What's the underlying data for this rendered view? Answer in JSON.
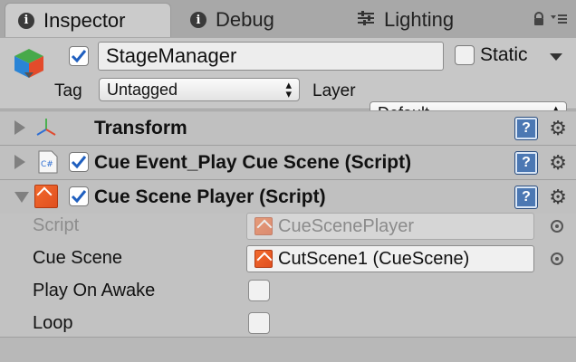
{
  "tabs": [
    {
      "label": "Inspector",
      "icon": "info-icon",
      "active": true
    },
    {
      "label": "Debug",
      "icon": "info-icon",
      "active": false
    },
    {
      "label": "Lighting",
      "icon": "sliders-icon",
      "active": false
    }
  ],
  "header": {
    "object_name": "StageManager",
    "active_checked": true,
    "static_label": "Static",
    "static_checked": false,
    "tag_label": "Tag",
    "tag_value": "Untagged",
    "layer_label": "Layer",
    "layer_value": "Default"
  },
  "components": [
    {
      "title": "Transform",
      "expanded": false,
      "checkbox": false,
      "icon": "transform-axes-icon"
    },
    {
      "title": "Cue Event_Play Cue Scene (Script)",
      "expanded": false,
      "checkbox": true,
      "icon": "csharp-script-icon"
    },
    {
      "title": "Cue Scene Player (Script)",
      "expanded": true,
      "checkbox": true,
      "icon": "cue-scene-icon"
    }
  ],
  "cue_scene_player": {
    "properties": [
      {
        "label": "Script",
        "value": "CueScenePlayer",
        "type": "object",
        "disabled": true
      },
      {
        "label": "Cue Scene",
        "value": "CutScene1 (CueScene)",
        "type": "object",
        "disabled": false
      },
      {
        "label": "Play On Awake",
        "type": "checkbox",
        "checked": false
      },
      {
        "label": "Loop",
        "type": "checkbox",
        "checked": false
      }
    ]
  },
  "colors": {
    "panel_bg": "#c2c2c2",
    "tab_bar_bg": "#a8a8a8",
    "check_blue": "#1f5fbf",
    "help_blue": "#4c78b3",
    "asset_orange": "#f26a2d"
  }
}
